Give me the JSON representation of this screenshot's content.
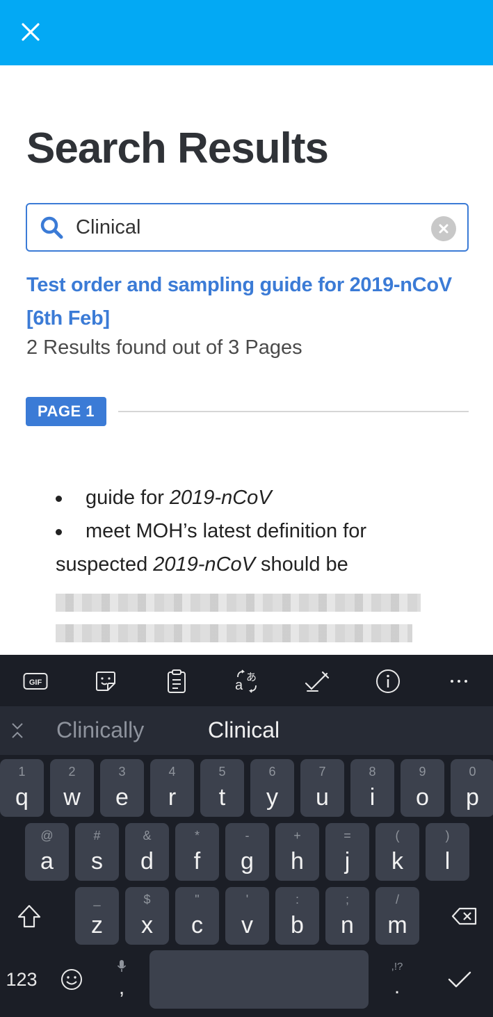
{
  "header": {
    "close_icon": "close-icon",
    "bar_color": "#03a9f4"
  },
  "page_title": "Search Results",
  "search": {
    "value": "Clinical",
    "placeholder": "",
    "icon": "search-icon",
    "clear_icon": "clear-circle-icon"
  },
  "result": {
    "title": "Test order and sampling guide for 2019-nCoV [6th Feb]",
    "summary": "2 Results found out of 3 Pages"
  },
  "page_badge": "PAGE 1",
  "snippets": {
    "item1_prefix": "guide for ",
    "item1_term": "2019-nCoV",
    "item2_text": "meet MOH’s latest definition for",
    "item2_cont_prefix": "suspected ",
    "item2_cont_term": "2019-nCoV",
    "item2_cont_suffix": " should be"
  },
  "keyboard": {
    "toolbar": [
      "gif-icon",
      "sticker-icon",
      "clipboard-icon",
      "translate-icon",
      "handwriting-icon",
      "info-icon",
      "more-icon"
    ],
    "suggestions": {
      "left": "Clinically",
      "main": "Clinical"
    },
    "row1": [
      {
        "k": "q",
        "h": "1"
      },
      {
        "k": "w",
        "h": "2"
      },
      {
        "k": "e",
        "h": "3"
      },
      {
        "k": "r",
        "h": "4"
      },
      {
        "k": "t",
        "h": "5"
      },
      {
        "k": "y",
        "h": "6"
      },
      {
        "k": "u",
        "h": "7"
      },
      {
        "k": "i",
        "h": "8"
      },
      {
        "k": "o",
        "h": "9"
      },
      {
        "k": "p",
        "h": "0"
      }
    ],
    "row2": [
      {
        "k": "a",
        "h": "@"
      },
      {
        "k": "s",
        "h": "#"
      },
      {
        "k": "d",
        "h": "&"
      },
      {
        "k": "f",
        "h": "*"
      },
      {
        "k": "g",
        "h": "-"
      },
      {
        "k": "h",
        "h": "+"
      },
      {
        "k": "j",
        "h": "="
      },
      {
        "k": "k",
        "h": "("
      },
      {
        "k": "l",
        "h": ")"
      }
    ],
    "row3": [
      {
        "k": "z",
        "h": "_"
      },
      {
        "k": "x",
        "h": "$"
      },
      {
        "k": "c",
        "h": "\""
      },
      {
        "k": "v",
        "h": "'"
      },
      {
        "k": "b",
        "h": ":"
      },
      {
        "k": "n",
        "h": ";"
      },
      {
        "k": "m",
        "h": "/"
      }
    ],
    "numbers_label": "123",
    "comma": ",",
    "period": ".",
    "period_hint": ",!?"
  }
}
